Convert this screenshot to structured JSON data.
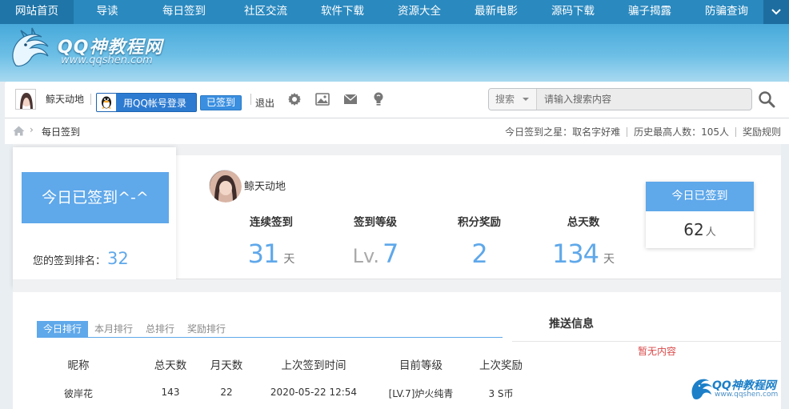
{
  "top_nav": {
    "items": [
      "网站首页",
      "导读",
      "每日签到",
      "社区交流",
      "软件下载",
      "资源大全",
      "最新电影",
      "源码下载",
      "骗子揭露",
      "防骗查询"
    ]
  },
  "site_logo": {
    "name": "QQ神教程网",
    "url": "www.qqshen.com"
  },
  "toolbar": {
    "username": "鲸天动地",
    "qq_login_label": "用QQ帐号登录",
    "signed_label": "已签到",
    "logout_label": "退出",
    "icons": [
      "gear-icon",
      "image-icon",
      "mail-icon",
      "lightbulb-icon"
    ]
  },
  "search": {
    "scope": "搜索",
    "placeholder": "请输入搜索内容"
  },
  "breadcrumb": {
    "current": "每日签到",
    "star_label": "今日签到之星：取名字好难",
    "record_label": "历史最高人数：105人",
    "rules_label": "奖励规则"
  },
  "checkin": {
    "button_label": "今日已签到^-^",
    "rank_label": "您的签到排名：",
    "rank_value": "32"
  },
  "profile": {
    "username": "鲸天动地"
  },
  "stats": [
    {
      "label": "连续签到",
      "value": "31",
      "unit": "天",
      "prefix": ""
    },
    {
      "label": "签到等级",
      "value": "7",
      "unit": "",
      "prefix": "Lv."
    },
    {
      "label": "积分奖励",
      "value": "2",
      "unit": "",
      "prefix": ""
    },
    {
      "label": "总天数",
      "value": "134",
      "unit": "天",
      "prefix": ""
    }
  ],
  "today_card": {
    "title": "今日已签到",
    "count": "62",
    "unit": "人"
  },
  "ranking": {
    "tabs": [
      "今日排行",
      "本月排行",
      "总排行",
      "奖励排行"
    ],
    "active_tab": 0,
    "columns": [
      "昵称",
      "总天数",
      "月天数",
      "上次签到时间",
      "目前等级",
      "上次奖励"
    ],
    "rows": [
      [
        "彼岸花",
        "143",
        "22",
        "2020-05-22 12:54",
        "[LV.7]炉火纯青",
        "3 S币"
      ]
    ]
  },
  "push": {
    "title": "推送信息",
    "empty": "暂无内容"
  },
  "watermark": {
    "name": "QQ神教程网",
    "url": "www.qqshen.com"
  },
  "colors": {
    "nav_bg": "#2a89bf",
    "accent": "#5fa8ea",
    "qq_button": "#2d7bd1",
    "empty_text": "#d94a4a"
  }
}
